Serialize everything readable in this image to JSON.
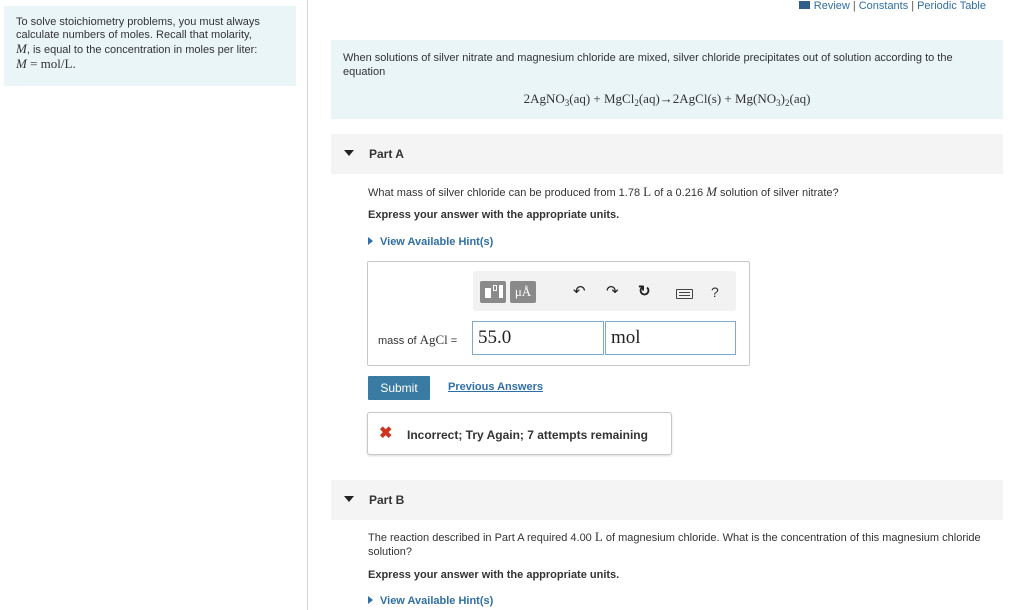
{
  "sidebar": {
    "text_line1": "To solve stoichiometry problems, you must always",
    "text_line2": "calculate numbers of moles. Recall that molarity,",
    "var_M": "M",
    "text_line3_rest": ", is equal to the concentration in moles per liter:",
    "formula_M": "M",
    "formula_eq": " = mol/L."
  },
  "toplinks": {
    "review": "Review",
    "constants": "Constants",
    "periodic": "Periodic Table",
    "separator": "|"
  },
  "intro": {
    "text": "When solutions of silver nitrate and magnesium chloride are mixed, silver chloride precipitates out of solution according to the equation",
    "eq": {
      "t1": "2AgNO",
      "s1": "3",
      "t2": "(aq) + MgCl",
      "s2": "2",
      "t3": "(aq)→2AgCl(s) + Mg(NO",
      "s3": "3",
      "t4": ")",
      "s4": "2",
      "t5": "(aq)"
    }
  },
  "partA": {
    "label": "Part A",
    "q_pre": "What mass of silver chloride can be produced from 1.78 ",
    "q_unit_L": "L",
    "q_mid": " of a 0.216 ",
    "q_var_M": "M",
    "q_post": " solution of silver nitrate?",
    "instruction": "Express your answer with the appropriate units.",
    "hint": "View Available Hint(s)",
    "toolbar": {
      "units_button": "μÅ",
      "undo_icon": "↶",
      "redo_icon": "↷",
      "reset_icon": "↻",
      "help": "?"
    },
    "answer_label_pre": "mass of ",
    "answer_label_formula": "AgCl",
    "answer_label_post": " =",
    "answer_value": "55.0",
    "answer_unit": "mol",
    "submit": "Submit",
    "previous_answers": "Previous Answers",
    "feedback_icon": "✖",
    "feedback": "Incorrect; Try Again; 7 attempts remaining"
  },
  "partB": {
    "label": "Part B",
    "q_pre": "The reaction described in Part A required 4.00 ",
    "q_unit_L": "L",
    "q_post": " of magnesium chloride. What is the concentration of this magnesium chloride solution?",
    "instruction": "Express your answer with the appropriate units.",
    "hint": "View Available Hint(s)"
  }
}
